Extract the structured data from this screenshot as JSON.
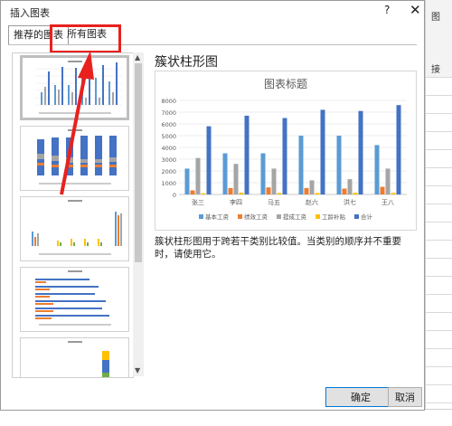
{
  "dialog": {
    "title": "插入图表",
    "help": "?",
    "close": "✕",
    "tabs": [
      {
        "label": "推荐的图表"
      },
      {
        "label": "所有图表"
      }
    ]
  },
  "preview": {
    "chart_type_name": "簇状柱形图",
    "description": "簇状柱形图用于跨若干类别比较值。当类别的顺序并不重要时，请使用它。"
  },
  "buttons": {
    "ok": "确定",
    "cancel": "取消"
  },
  "background": {
    "ribbon_text_1": "图",
    "ribbon_text_2": "接"
  },
  "chart_data": {
    "type": "bar",
    "title": "图表标题",
    "categories": [
      "张三",
      "李四",
      "马五",
      "赵六",
      "洪七",
      "王八"
    ],
    "ylim": [
      0,
      8000
    ],
    "yticks": [
      0,
      1000,
      2000,
      3000,
      4000,
      5000,
      6000,
      7000,
      8000
    ],
    "grid": true,
    "legend_position": "bottom",
    "series": [
      {
        "name": "基本工资",
        "color": "#5b9bd5",
        "values": [
          2200,
          3500,
          3500,
          5000,
          5000,
          4200
        ]
      },
      {
        "name": "绩效工资",
        "color": "#ed7d31",
        "values": [
          350,
          550,
          600,
          550,
          500,
          650
        ]
      },
      {
        "name": "提成工资",
        "color": "#a5a5a5",
        "values": [
          3100,
          2600,
          2200,
          1200,
          1300,
          2200
        ]
      },
      {
        "name": "工龄补贴",
        "color": "#ffc000",
        "values": [
          100,
          150,
          120,
          130,
          140,
          130
        ]
      },
      {
        "name": "合计",
        "color": "#4472c4",
        "values": [
          5800,
          6700,
          6500,
          7200,
          7100,
          7600
        ]
      }
    ]
  }
}
